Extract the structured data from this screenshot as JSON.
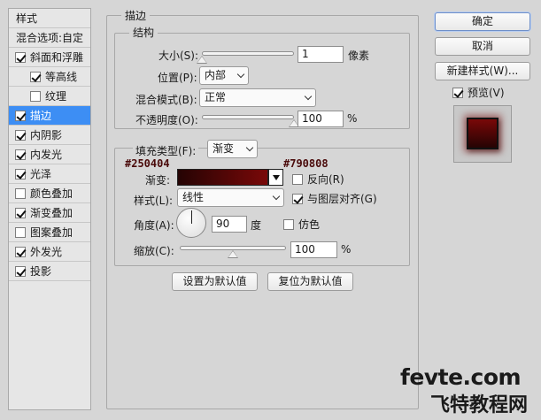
{
  "style_list": {
    "header": "样式",
    "blend_options": "混合选项:自定",
    "items": [
      {
        "label": "斜面和浮雕",
        "checked": true
      },
      {
        "label": "等高线",
        "checked": true
      },
      {
        "label": "纹理",
        "checked": false
      },
      {
        "label": "描边",
        "checked": true,
        "selected": true
      },
      {
        "label": "内阴影",
        "checked": true
      },
      {
        "label": "内发光",
        "checked": true
      },
      {
        "label": "光泽",
        "checked": true
      },
      {
        "label": "颜色叠加",
        "checked": false
      },
      {
        "label": "渐变叠加",
        "checked": true
      },
      {
        "label": "图案叠加",
        "checked": false
      },
      {
        "label": "外发光",
        "checked": true
      },
      {
        "label": "投影",
        "checked": true
      }
    ]
  },
  "stroke": {
    "title": "描边",
    "structure": {
      "title": "结构",
      "size_label": "大小(S):",
      "size_value": "1",
      "size_unit": "像素",
      "size_slider_fraction": 0.0,
      "position_label": "位置(P):",
      "position_value": "内部",
      "blend_label": "混合模式(B):",
      "blend_value": "正常",
      "opacity_label": "不透明度(O):",
      "opacity_value": "100",
      "opacity_unit": "%",
      "opacity_slider_fraction": 1.0
    },
    "fill": {
      "fill_type_label": "填充类型(F):",
      "fill_type_value": "渐变",
      "color_start": "#250404",
      "color_end": "#790808",
      "gradient_label": "渐变:",
      "reverse_label": "反向(R)",
      "reverse_checked": false,
      "style_label": "样式(L):",
      "style_value": "线性",
      "align_label": "与图层对齐(G)",
      "align_checked": true,
      "angle_label": "角度(A):",
      "angle_value": "90",
      "angle_unit": "度",
      "dither_label": "仿色",
      "dither_checked": false,
      "scale_label": "缩放(C):",
      "scale_value": "100",
      "scale_unit": "%",
      "scale_slider_fraction": 0.5
    },
    "make_default": "设置为默认值",
    "reset_default": "复位为默认值"
  },
  "right_panel": {
    "ok": "确定",
    "cancel": "取消",
    "new_style": "新建样式(W)...",
    "preview_label": "预览(V)",
    "preview_checked": true
  },
  "watermark": {
    "top": "fevte.com",
    "bottom": "飞特教程网"
  }
}
